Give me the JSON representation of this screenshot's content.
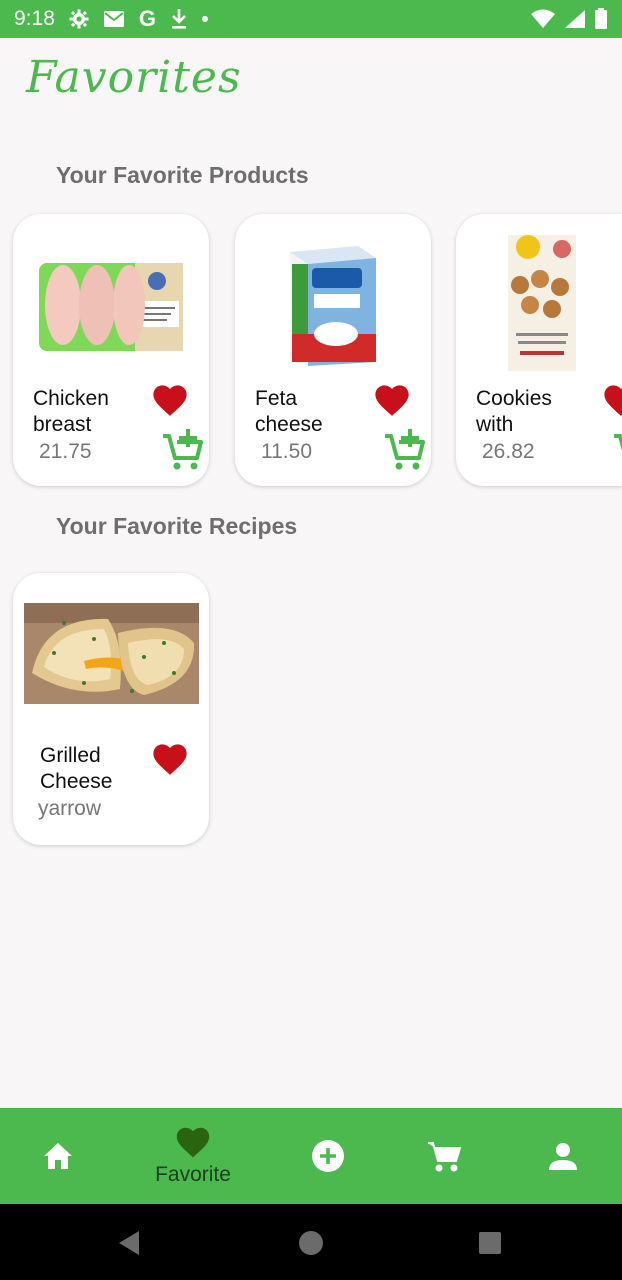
{
  "status_bar": {
    "time": "9:18",
    "icons": [
      "settings-icon",
      "mail-icon",
      "google-icon",
      "download-icon",
      "dot-icon"
    ],
    "right_icons": [
      "wifi-icon",
      "signal-icon",
      "battery-icon"
    ],
    "google_letter": "G"
  },
  "page": {
    "title": "Favorites"
  },
  "products_section": {
    "title": "Your Favorite Products",
    "items": [
      {
        "name": "Chicken breast",
        "price": "21.75"
      },
      {
        "name": "Feta cheese",
        "price": "11.50"
      },
      {
        "name": "Cookies with",
        "price": "26.82"
      }
    ]
  },
  "recipes_section": {
    "title": "Your Favorite Recipes",
    "items": [
      {
        "name": "Grilled Cheese",
        "author": "yarrow"
      }
    ]
  },
  "bottom_nav": {
    "items": [
      {
        "icon": "home-icon",
        "label": ""
      },
      {
        "icon": "heart-icon",
        "label": "Favorite",
        "active": true
      },
      {
        "icon": "add-circle-icon",
        "label": ""
      },
      {
        "icon": "cart-icon",
        "label": ""
      },
      {
        "icon": "person-icon",
        "label": ""
      }
    ]
  },
  "colors": {
    "primary": "#4cb94f",
    "heart": "#c8101a",
    "active_nav": "#2a6410",
    "background": "#f8f6f7"
  }
}
